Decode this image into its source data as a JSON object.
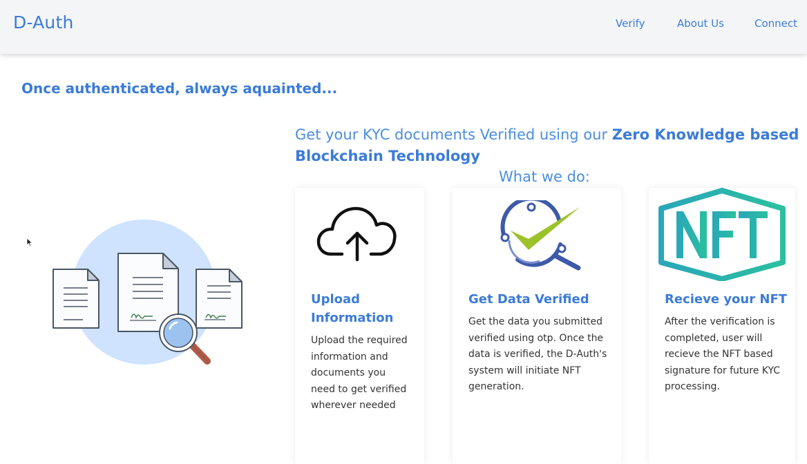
{
  "nav": {
    "brand": "D-Auth",
    "links": [
      "Verify",
      "About Us",
      "Connect"
    ]
  },
  "tagline": "Once authenticated, always aquainted...",
  "hero": {
    "lead": "Get your KYC documents Verified using our ",
    "bold": "Zero Knowledge based Blockchain Technology"
  },
  "section_title": "What we do:",
  "cards": [
    {
      "icon": "cloud-upload-icon",
      "title": "Upload Information",
      "body": "Upload the required information and documents you need to get verified wherever needed"
    },
    {
      "icon": "verified-search-icon",
      "title": "Get Data Verified",
      "body": "Get the data you submitted verified using otp. Once the data is verified, the D-Auth's system will initiate NFT generation."
    },
    {
      "icon": "nft-hexagon-icon",
      "title": "Recieve your NFT",
      "body": "After the verification is completed, user will recieve the NFT based signature for future KYC processing."
    }
  ],
  "colors": {
    "brand": "#3b7bd8",
    "navbar_bg": "#f4f5f7",
    "nft_teal": "#2aa7b8",
    "check_green": "#9cc22a",
    "illus_circle": "#cfe3ff"
  }
}
